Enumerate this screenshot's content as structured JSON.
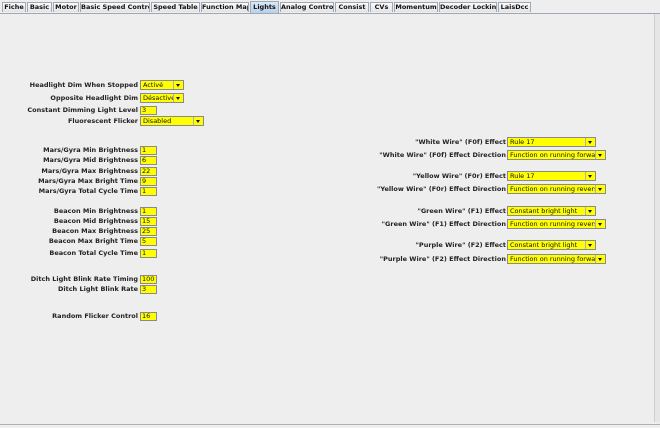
{
  "tabs": [
    {
      "label": "Fiche"
    },
    {
      "label": "Basic"
    },
    {
      "label": "Motor"
    },
    {
      "label": "Basic Speed Control"
    },
    {
      "label": "Speed Table"
    },
    {
      "label": "Function Map"
    },
    {
      "label": "Lights",
      "active": true
    },
    {
      "label": "Analog Controls"
    },
    {
      "label": "Consist"
    },
    {
      "label": "CVs"
    },
    {
      "label": "Momentum"
    },
    {
      "label": "Decoder Locking"
    },
    {
      "label": "LaisDcc"
    }
  ],
  "left": {
    "headlight_dim_label": "Headlight Dim When Stopped",
    "headlight_dim_value": "Activé",
    "opposite_headlight_label": "Opposite Headlight Dim",
    "opposite_headlight_value": "Désactivé",
    "constant_dimming_label": "Constant Dimming Light Level",
    "constant_dimming_value": "3",
    "fluorescent_label": "Fluorescent Flicker",
    "fluorescent_value": "Disabled",
    "mars_min_label": "Mars/Gyra Min Brightness",
    "mars_min_value": "1",
    "mars_mid_label": "Mars/Gyra Mid Brightness",
    "mars_mid_value": "6",
    "mars_max_label": "Mars/Gyra Max Brightness",
    "mars_max_value": "22",
    "mars_bright_time_label": "Mars/Gyra Max Bright Time",
    "mars_bright_time_value": "9",
    "mars_cycle_label": "Mars/Gyra Total Cycle Time",
    "mars_cycle_value": "1",
    "beacon_min_label": "Beacon Min Brightness",
    "beacon_min_value": "1",
    "beacon_mid_label": "Beacon Mid Brightness",
    "beacon_mid_value": "15",
    "beacon_max_label": "Beacon Max Brightness",
    "beacon_max_value": "25",
    "beacon_bright_time_label": "Beacon Max Bright Time",
    "beacon_bright_time_value": "5",
    "beacon_cycle_label": "Beacon Total Cycle Time",
    "beacon_cycle_value": "1",
    "ditch_timing_label": "Ditch Light Blink Rate Timing",
    "ditch_timing_value": "100",
    "ditch_rate_label": "Ditch Light Blink Rate",
    "ditch_rate_value": "3",
    "random_flicker_label": "Random Flicker Control",
    "random_flicker_value": "16"
  },
  "right": {
    "white_effect_label": "\"White Wire\" (F0f) Effect",
    "white_effect_value": "Rule 17",
    "white_dir_label": "\"White Wire\" (F0f) Effect Direction",
    "white_dir_value": "Function on running forward",
    "yellow_effect_label": "\"Yellow Wire\" (F0r) Effect",
    "yellow_effect_value": "Rule 17",
    "yellow_dir_label": "\"Yellow Wire\" (F0r) Effect Direction",
    "yellow_dir_value": "Function on running reverse",
    "green_effect_label": "\"Green Wire\" (F1) Effect",
    "green_effect_value": "Constant bright light",
    "green_dir_label": "\"Green Wire\" (F1) Effect Direction",
    "green_dir_value": "Function on running reverse",
    "purple_effect_label": "\"Purple Wire\" (F2) Effect",
    "purple_effect_value": "Constant bright light",
    "purple_dir_label": "\"Purple Wire\" (F2) Effect Direction",
    "purple_dir_value": "Function on running forward"
  },
  "colors": {
    "field_background": "#ffff00",
    "active_tab": "#c6dbf1",
    "panel_background": "#eeeeee"
  }
}
